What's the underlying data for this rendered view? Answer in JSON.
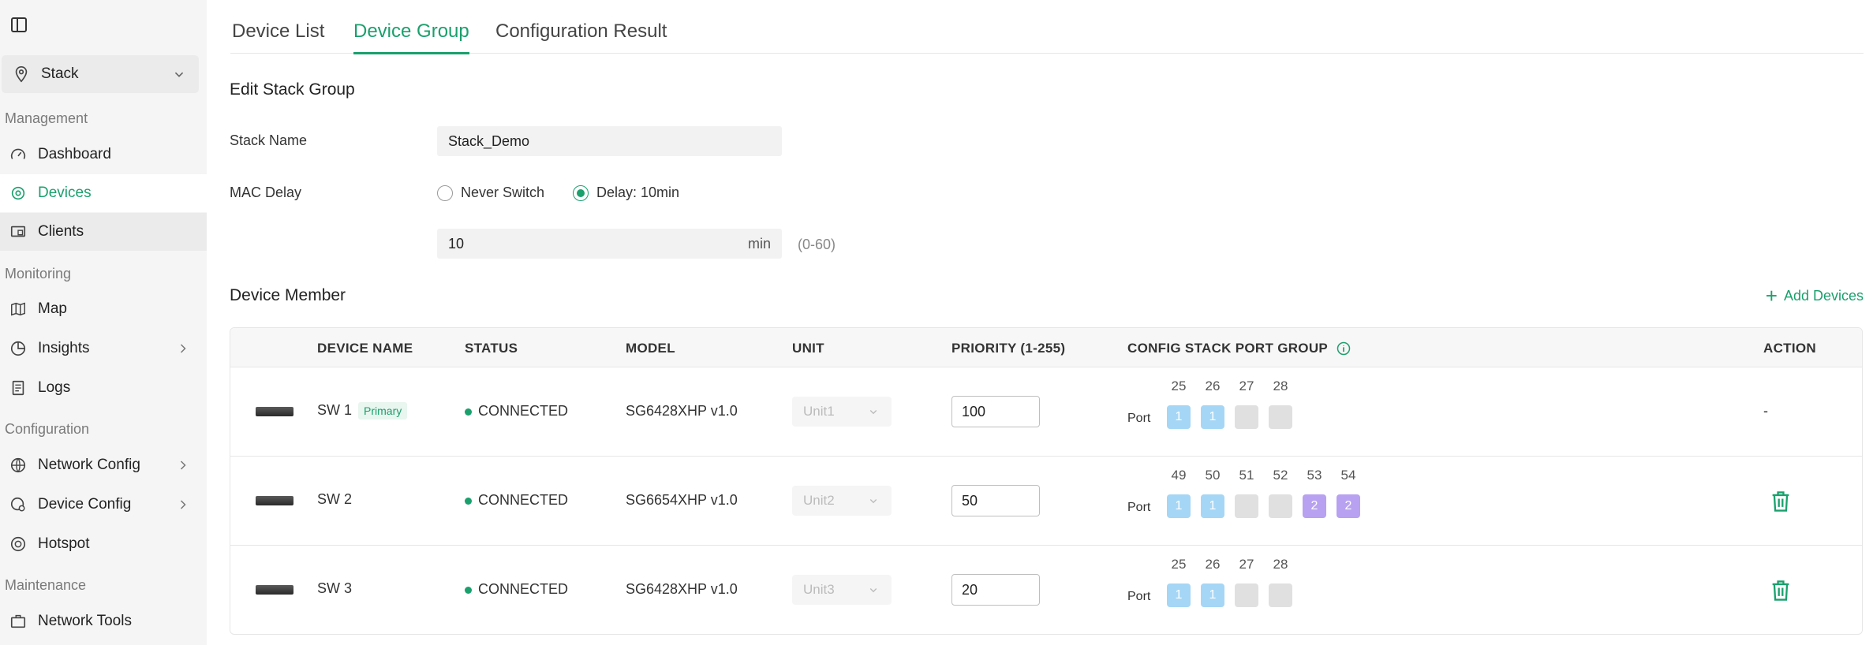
{
  "sidebar": {
    "site": "Stack",
    "sections": {
      "management": "Management",
      "monitoring": "Monitoring",
      "configuration": "Configuration",
      "maintenance": "Maintenance"
    },
    "items": {
      "dashboard": "Dashboard",
      "devices": "Devices",
      "clients": "Clients",
      "map": "Map",
      "insights": "Insights",
      "logs": "Logs",
      "network_config": "Network Config",
      "device_config": "Device Config",
      "hotspot": "Hotspot",
      "network_tools": "Network Tools"
    }
  },
  "tabs": {
    "device_list": "Device List",
    "device_group": "Device Group",
    "configuration_result": "Configuration Result"
  },
  "form": {
    "title": "Edit Stack Group",
    "stack_name_label": "Stack Name",
    "stack_name_value": "Stack_Demo",
    "mac_delay_label": "MAC Delay",
    "option_never": "Never Switch",
    "option_delay": "Delay: 10min",
    "delay_value": "10",
    "delay_unit": "min",
    "delay_range": "(0-60)"
  },
  "members": {
    "title": "Device Member",
    "add_label": "Add Devices",
    "headers": {
      "name": "DEVICE NAME",
      "status": "STATUS",
      "model": "MODEL",
      "unit": "UNIT",
      "priority": "PRIORITY (1-255)",
      "port_group": "CONFIG STACK PORT GROUP",
      "action": "ACTION"
    },
    "port_label": "Port",
    "rows": [
      {
        "name": "SW 1",
        "badge": "Primary",
        "status": "CONNECTED",
        "model": "SG6428XHP v1.0",
        "unit": "Unit1",
        "priority": "100",
        "action": "-",
        "ports": [
          {
            "num": "25",
            "val": "1",
            "color": "blue"
          },
          {
            "num": "26",
            "val": "1",
            "color": "blue"
          },
          {
            "num": "27",
            "val": "",
            "color": "gray"
          },
          {
            "num": "28",
            "val": "",
            "color": "gray"
          }
        ]
      },
      {
        "name": "SW 2",
        "status": "CONNECTED",
        "model": "SG6654XHP v1.0",
        "unit": "Unit2",
        "priority": "50",
        "ports": [
          {
            "num": "49",
            "val": "1",
            "color": "blue"
          },
          {
            "num": "50",
            "val": "1",
            "color": "blue"
          },
          {
            "num": "51",
            "val": "",
            "color": "gray"
          },
          {
            "num": "52",
            "val": "",
            "color": "gray"
          },
          {
            "num": "53",
            "val": "2",
            "color": "purple"
          },
          {
            "num": "54",
            "val": "2",
            "color": "purple"
          }
        ]
      },
      {
        "name": "SW 3",
        "status": "CONNECTED",
        "model": "SG6428XHP v1.0",
        "unit": "Unit3",
        "priority": "20",
        "ports": [
          {
            "num": "25",
            "val": "1",
            "color": "blue"
          },
          {
            "num": "26",
            "val": "1",
            "color": "blue"
          },
          {
            "num": "27",
            "val": "",
            "color": "gray"
          },
          {
            "num": "28",
            "val": "",
            "color": "gray"
          }
        ]
      }
    ]
  },
  "colors": {
    "accent": "#1aa06d",
    "port_blue": "#a6d6f5",
    "port_gray": "#e0e0e0",
    "port_purple": "#b7a1f0"
  }
}
